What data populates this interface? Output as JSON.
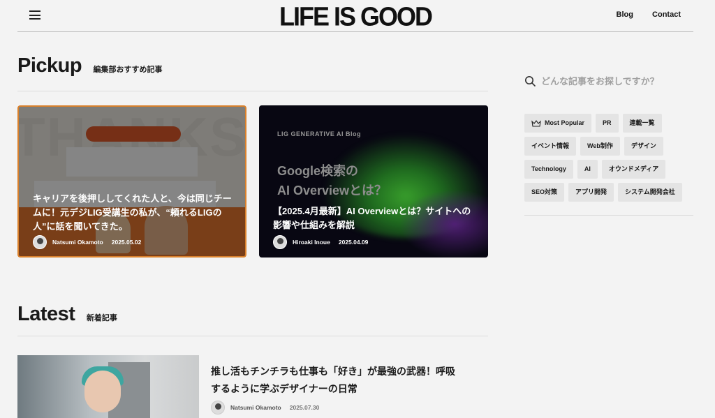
{
  "header": {
    "logo": "LIFE IS GOOD",
    "nav": [
      {
        "label": "Blog"
      },
      {
        "label": "Contact"
      }
    ]
  },
  "pickup": {
    "heading": "Pickup",
    "subheading": "編集部おすすめ記事",
    "cards": [
      {
        "title": "キャリアを後押ししてくれた人と、今は同じチームに！元デジLIG受講生の私が、“頼れるLIGの人”に話を聞いてきた。",
        "author": "Natsumi Okamoto",
        "date": "2025.05.02"
      },
      {
        "title": "【2025.4月最新】AI Overviewとは？サイトへの影響や仕組みを解説",
        "author": "Hiroaki Inoue",
        "date": "2025.04.09",
        "image_brand": "LIG GENERATIVE AI Blog",
        "image_headline": [
          "Google検索の",
          "AI Overviewとは？"
        ]
      }
    ]
  },
  "sidebar": {
    "search_placeholder": "どんな記事をお探しですか？",
    "tags": [
      {
        "label": "Most Popular",
        "icon": "crown-icon"
      },
      {
        "label": "PR"
      },
      {
        "label": "連載一覧"
      },
      {
        "label": "イベント情報"
      },
      {
        "label": "Web制作"
      },
      {
        "label": "デザイン"
      },
      {
        "label": "Technology"
      },
      {
        "label": "AI"
      },
      {
        "label": "オウンドメディア"
      },
      {
        "label": "SEO対策"
      },
      {
        "label": "アプリ開発"
      },
      {
        "label": "システム開発会社"
      }
    ]
  },
  "latest": {
    "heading": "Latest",
    "subheading": "新着記事",
    "items": [
      {
        "title": "推し活もチンチラも仕事も「好き」が最強の武器！呼吸するように学ぶデザイナーの日常",
        "author": "Natsumi Okamoto",
        "date": "2025.07.30"
      }
    ]
  }
}
